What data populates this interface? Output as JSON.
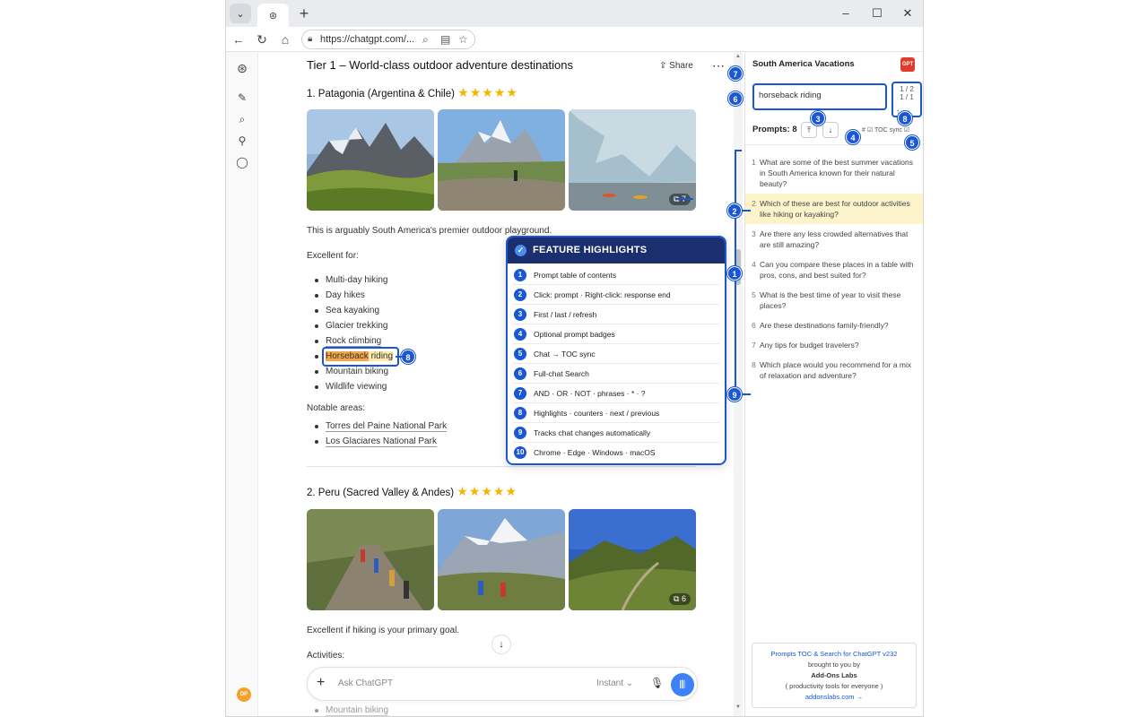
{
  "browser": {
    "url": "https://chatgpt.com/...",
    "tab_icon": "openai-icon"
  },
  "chat": {
    "tier_title": "Tier 1 – World-class outdoor adventure destinations",
    "share_label": "Share",
    "section1": {
      "title": "1. Patagonia (Argentina & Chile)",
      "stars": "★★★★★",
      "photo_more": "7",
      "intro": "This is arguably South America's premier outdoor playground.",
      "excellent_for": "Excellent for:",
      "activities": [
        "Multi-day hiking",
        "Day hikes",
        "Sea kayaking",
        "Glacier trekking",
        "Rock climbing"
      ],
      "horseback_word": "Horseback",
      "riding_word": " riding",
      "activities_after": [
        "Mountain biking",
        "Wildlife viewing"
      ],
      "notable_label": "Notable areas:",
      "notable": [
        "Torres del Paine National Park",
        "Los Glaciares National Park"
      ]
    },
    "section2": {
      "title": "2. Peru (Sacred Valley & Andes)",
      "stars": "★★★★★",
      "photo_more": "6",
      "intro": "Excellent if hiking is your primary goal.",
      "activities_label": "Activities:",
      "cut_item": "Mountain biking"
    },
    "composer": {
      "placeholder": "Ask ChatGPT",
      "mode": "Instant"
    },
    "avatar_initials": "DP"
  },
  "features": {
    "title": "FEATURE HIGHLIGHTS",
    "items": [
      {
        "n": "1",
        "label": "Prompt table of contents"
      },
      {
        "n": "2",
        "label": "Click: prompt · Right-click: response end"
      },
      {
        "n": "3",
        "label": "First / last / refresh"
      },
      {
        "n": "4",
        "label": "Optional prompt badges"
      },
      {
        "n": "5",
        "label": "Chat → TOC sync"
      },
      {
        "n": "6",
        "label": "Full-chat Search"
      },
      {
        "n": "7",
        "label": "AND · OR · NOT · phrases · * · ?"
      },
      {
        "n": "8",
        "label": "Highlights · counters · next / previous"
      },
      {
        "n": "9",
        "label": "Tracks chat changes automatically"
      },
      {
        "n": "10",
        "label": "Chrome · Edge · Windows · macOS"
      }
    ]
  },
  "callouts": [
    "1",
    "2",
    "3",
    "4",
    "5",
    "6",
    "7",
    "8",
    "8",
    "9"
  ],
  "panel": {
    "title": "South America Vacations",
    "logo_text": "GPT",
    "search_value": "horseback riding",
    "counter_top": "1 / 2",
    "counter_bottom": "1 / 1",
    "prompts_label": "Prompts: 8",
    "hash_label": "#",
    "toc_sync_label": "TOC sync",
    "prompts": [
      {
        "n": "1",
        "text": "What are some of the best summer vacations in South America known for their natural beauty?"
      },
      {
        "n": "2",
        "text": "Which of these are best for outdoor activities like hiking or kayaking?"
      },
      {
        "n": "3",
        "text": "Are there any less crowded alternatives that are still amazing?"
      },
      {
        "n": "4",
        "text": "Can you compare these places in a table with pros, cons, and best suited for?"
      },
      {
        "n": "5",
        "text": "What is the best time of year to visit these places?"
      },
      {
        "n": "6",
        "text": "Are these destinations family-friendly?"
      },
      {
        "n": "7",
        "text": "Any tips for budget travelers?"
      },
      {
        "n": "8",
        "text": "Which place would you recommend for a mix of relaxation and adventure?"
      }
    ],
    "footer": {
      "line1": "Prompts TOC & Search for ChatGPT v232",
      "line2": "brought to you by",
      "line3": "Add-Ons Labs",
      "line4": "( productivity tools for everyone )",
      "line5": "addonslabs.com →"
    }
  },
  "colors": {
    "accent": "#1a57d6",
    "feature_header": "#1b2f6e",
    "active_prompt": "#fdf4cc",
    "highlight_current": "#f4a64a",
    "highlight_other": "#fde9a8",
    "voice_button": "#3e82f7"
  }
}
